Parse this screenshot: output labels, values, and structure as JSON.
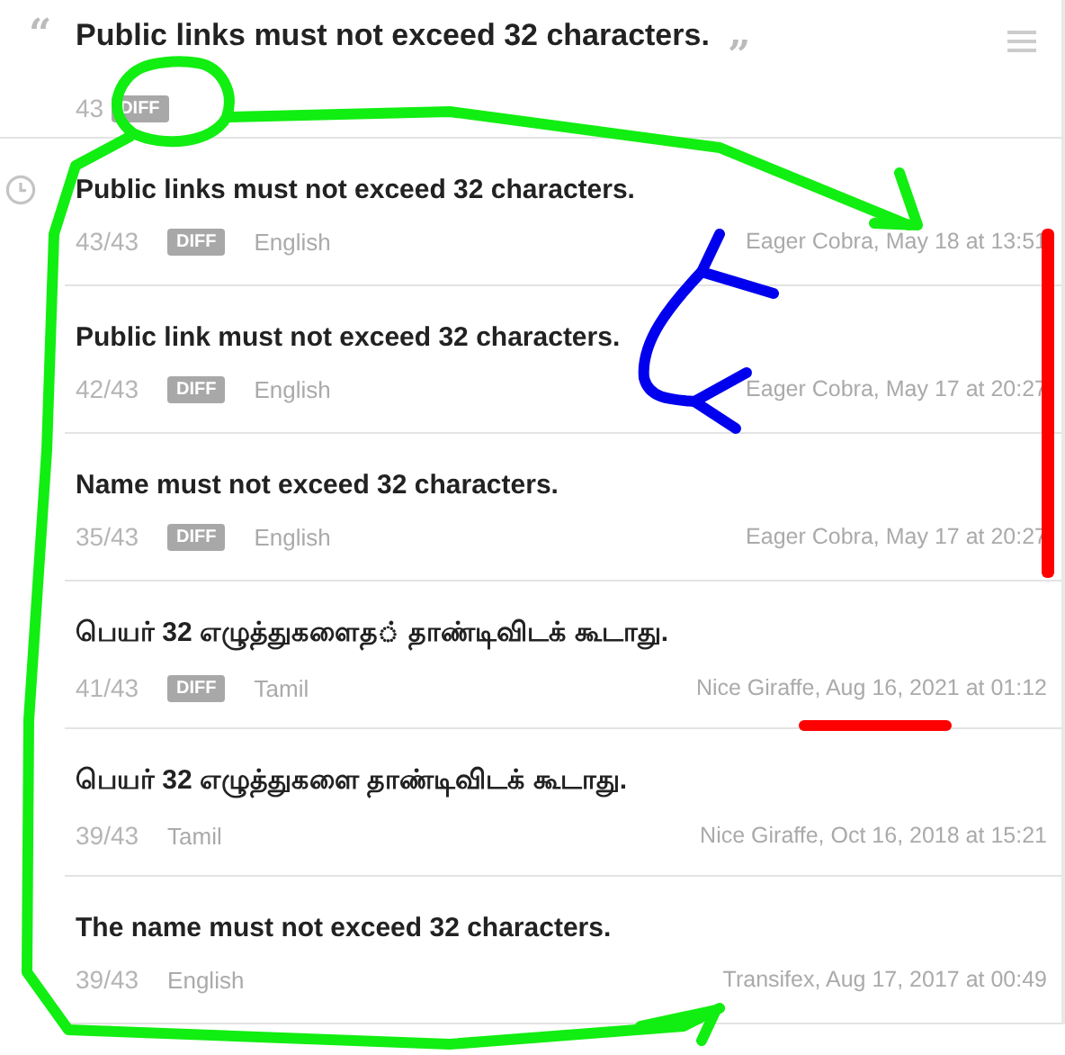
{
  "source": {
    "open_quote": "“",
    "close_quote": "”",
    "text": "Public links must not exceed 32 characters.",
    "count": "43",
    "diff": "DIFF"
  },
  "history": [
    {
      "text": "Public links must not exceed 32 characters.",
      "count": "43/43",
      "diff": "DIFF",
      "language": "English",
      "meta": "Eager Cobra, May 18 at 13:51"
    },
    {
      "text": "Public link must not exceed 32 characters.",
      "count": "42/43",
      "diff": "DIFF",
      "language": "English",
      "meta": "Eager Cobra, May 17 at 20:27"
    },
    {
      "text": "Name must not exceed 32 characters.",
      "count": "35/43",
      "diff": "DIFF",
      "language": "English",
      "meta": "Eager Cobra, May 17 at 20:27"
    },
    {
      "text": "பெயர் 32 எழுத்துகளைத◌் தாண்டிவிடக் கூடாது.",
      "count": "41/43",
      "diff": "DIFF",
      "language": "Tamil",
      "meta": "Nice Giraffe, Aug 16, 2021 at 01:12"
    },
    {
      "text": "பெயர் 32 எழுத்துகளை தாண்டிவிடக் கூடாது.",
      "count": "39/43",
      "language": "Tamil",
      "meta": "Nice Giraffe, Oct 16, 2018 at 15:21"
    },
    {
      "text": "The name must not exceed 32 characters.",
      "count": "39/43",
      "language": "English",
      "meta": "Transifex, Aug 17, 2017 at 00:49"
    }
  ]
}
